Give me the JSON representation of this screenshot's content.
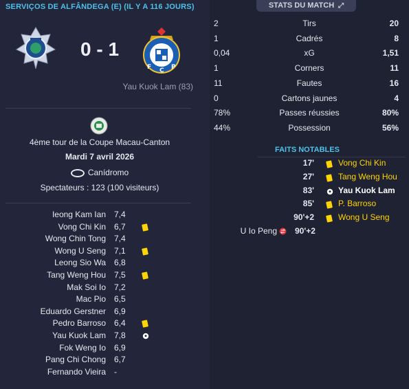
{
  "match": {
    "header": "SERVIÇOS DE ALFÂNDEGA (E) (IL Y A 116 JOURS)",
    "score": "0 - 1",
    "scorer": "Yau Kuok Lam (83)",
    "competition_round": "4ème tour de la Coupe Macau-Canton",
    "date": "Mardi 7 avril 2026",
    "venue": "Canídromo",
    "attendance": "Spectateurs : 123 (100 visiteurs)"
  },
  "ratings": [
    {
      "name": "Ieong Kam Ian",
      "rating": "7,4",
      "icon": ""
    },
    {
      "name": "Vong Chi Kin",
      "rating": "6,7",
      "icon": "yellow-card-icon"
    },
    {
      "name": "Wong Chin Tong",
      "rating": "7,4",
      "icon": ""
    },
    {
      "name": "Wong U Seng",
      "rating": "7,1",
      "icon": "yellow-card-icon"
    },
    {
      "name": "Leong Sio Wa",
      "rating": "6,8",
      "icon": ""
    },
    {
      "name": "Tang Weng Hou",
      "rating": "7,5",
      "icon": "yellow-card-icon"
    },
    {
      "name": "Mak Soi Io",
      "rating": "7,2",
      "icon": ""
    },
    {
      "name": "Mac Pio",
      "rating": "6,5",
      "icon": ""
    },
    {
      "name": "Eduardo Gerstner",
      "rating": "6,9",
      "icon": ""
    },
    {
      "name": "Pedro Barroso",
      "rating": "6,4",
      "icon": "yellow-card-icon"
    },
    {
      "name": "Yau Kuok Lam",
      "rating": "7,8",
      "icon": "goal-icon"
    },
    {
      "name": "Fok Weng Io",
      "rating": "6,9",
      "icon": ""
    },
    {
      "name": "Pang Chi Chong",
      "rating": "6,7",
      "icon": ""
    },
    {
      "name": "Fernando Vieira",
      "rating": "-",
      "icon": ""
    }
  ],
  "stats": {
    "title": "STATS DU MATCH",
    "rows": [
      {
        "home": "2",
        "label": "Tirs",
        "away": "20",
        "home_bold": false,
        "away_bold": true
      },
      {
        "home": "1",
        "label": "Cadrés",
        "away": "8",
        "home_bold": false,
        "away_bold": true
      },
      {
        "home": "0,04",
        "label": "xG",
        "away": "1,51",
        "home_bold": false,
        "away_bold": true
      },
      {
        "home": "1",
        "label": "Corners",
        "away": "11",
        "home_bold": false,
        "away_bold": true
      },
      {
        "home": "11",
        "label": "Fautes",
        "away": "16",
        "home_bold": false,
        "away_bold": true
      },
      {
        "home": "0",
        "label": "Cartons jaunes",
        "away": "4",
        "home_bold": false,
        "away_bold": true
      },
      {
        "home": "78%",
        "label": "Passes réussies",
        "away": "80%",
        "home_bold": false,
        "away_bold": true
      },
      {
        "home": "44%",
        "label": "Possession",
        "away": "56%",
        "home_bold": false,
        "away_bold": true
      }
    ]
  },
  "notable": {
    "title": "FAITS NOTABLES",
    "events": [
      {
        "minute": "17'",
        "player": "Vong Chi Kin",
        "icon": "yellow-card-icon",
        "side": "away"
      },
      {
        "minute": "27'",
        "player": "Tang Weng Hou",
        "icon": "yellow-card-icon",
        "side": "away"
      },
      {
        "minute": "83'",
        "player": "Yau Kuok Lam",
        "icon": "goal-icon",
        "side": "away"
      },
      {
        "minute": "85'",
        "player": "P. Barroso",
        "icon": "yellow-card-icon",
        "side": "away"
      },
      {
        "minute": "90'+2",
        "player": "Wong U Seng",
        "icon": "yellow-card-icon",
        "side": "away"
      },
      {
        "minute": "90'+2",
        "player": "U Io Peng",
        "icon": "substitution-icon",
        "side": "home"
      }
    ]
  },
  "colors": {
    "accent": "#4fc1e9",
    "yellow_card": "#ffd400",
    "background": "#23263a",
    "panel": "#1f2233"
  }
}
